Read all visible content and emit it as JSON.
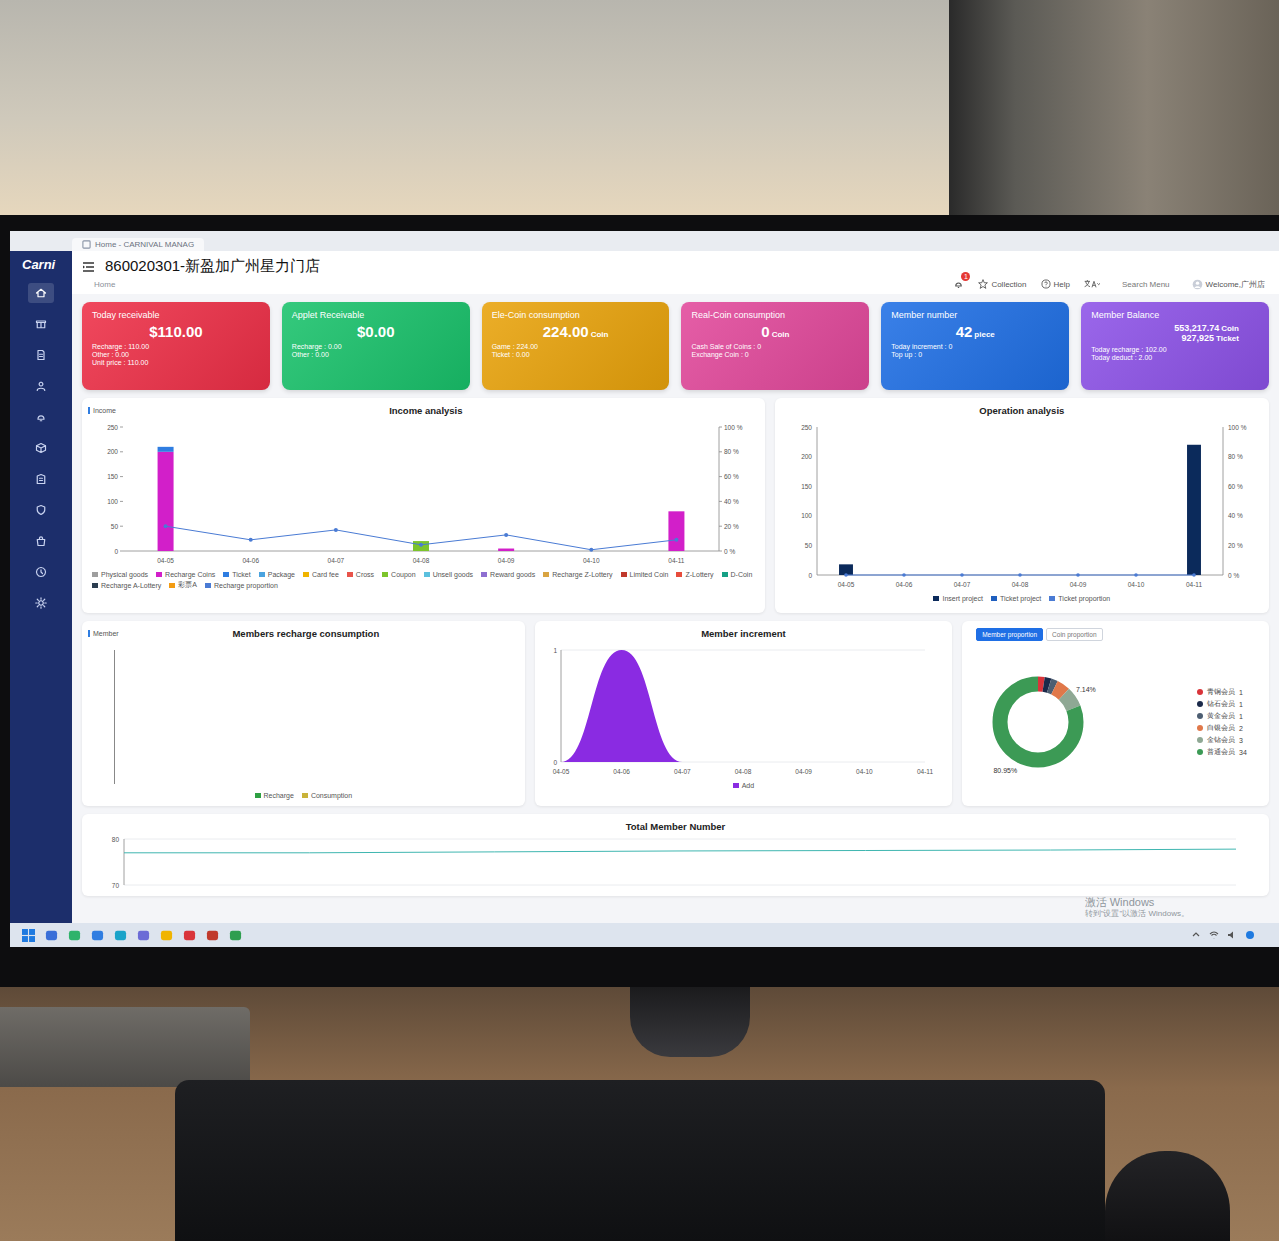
{
  "browser_tab": {
    "title": "Home - CARNIVAL MANAG"
  },
  "logo": "Carni",
  "sidebar": {
    "items": [
      {
        "selected": true
      },
      {
        "selected": false
      },
      {
        "selected": false
      },
      {
        "selected": false
      },
      {
        "selected": false
      },
      {
        "selected": false
      },
      {
        "selected": false
      },
      {
        "selected": false
      },
      {
        "selected": false
      },
      {
        "selected": false
      },
      {
        "selected": false
      }
    ]
  },
  "header": {
    "title": "860020301-新盈加广州星力门店",
    "breadcrumb": "Home",
    "notifications": "1",
    "collection": "Collection",
    "help": "Help",
    "search": "Search Menu",
    "welcome": "Welcome,广州店"
  },
  "cards": [
    {
      "title": "Today receivable",
      "color": "#ee2f47",
      "values": [
        {
          "value": "$110.00"
        }
      ],
      "lines": [
        "Recharge : 110.00",
        "Other : 0.00",
        "Unit price : 110.00"
      ]
    },
    {
      "title": "Applet Receivable",
      "color": "#19c26b",
      "values": [
        {
          "value": "$0.00"
        }
      ],
      "lines": [
        "Recharge : 0.00",
        "Other : 0.00"
      ]
    },
    {
      "title": "Ele-Coin consumption",
      "color": "#e9a30b",
      "values": [
        {
          "value": "224.00",
          "unit": "Coin"
        }
      ],
      "lines": [
        "Game : 224.00",
        "Ticket : 0.00"
      ]
    },
    {
      "title": "Real-Coin consumption",
      "color": "#e2489b",
      "values": [
        {
          "value": "0",
          "unit": "Coin"
        }
      ],
      "lines": [
        "Cash Sale of Coins : 0",
        "Exchange Coin : 0"
      ]
    },
    {
      "title": "Member number",
      "color": "#1f6fe5",
      "values": [
        {
          "value": "42",
          "unit": "piece"
        }
      ],
      "lines": [
        "Today increment : 0",
        "Top up : 0"
      ]
    },
    {
      "title": "Member Balance",
      "color": "#8d52e8",
      "values": [
        {
          "value": "553,217.74",
          "unit": "Coin"
        },
        {
          "value": "927,925",
          "unit": "Ticket"
        }
      ],
      "lines": [
        "Today recharge : 102.00",
        "Today deduct : 2.00"
      ]
    }
  ],
  "income": {
    "axis_label": "Income",
    "title": "Income analysis",
    "y_ticks": [
      "250",
      "200",
      "150",
      "100",
      "50",
      "0"
    ],
    "y2_ticks": [
      "100 %",
      "80 %",
      "60 %",
      "40 %",
      "20 %",
      "0 %"
    ],
    "categories": [
      "04-05",
      "04-06",
      "04-07",
      "04-08",
      "04-09",
      "04-10",
      "04-11"
    ],
    "series": [
      {
        "name": "Physical goods",
        "color": "#9e9e9e",
        "values": [
          0,
          0,
          0,
          0,
          0,
          0,
          0
        ]
      },
      {
        "name": "Recharge Coins",
        "color": "#d21fc9",
        "values": [
          200,
          0,
          0,
          0,
          5,
          0,
          80
        ]
      },
      {
        "name": "Ticket",
        "color": "#2f7de1",
        "values": [
          10,
          0,
          0,
          0,
          0,
          0,
          0
        ]
      },
      {
        "name": "Package",
        "color": "#4aa3df",
        "values": [
          0,
          0,
          0,
          0,
          0,
          0,
          0
        ]
      },
      {
        "name": "Card fee",
        "color": "#f0b400",
        "values": [
          0,
          0,
          0,
          0,
          0,
          0,
          0
        ]
      },
      {
        "name": "Cross",
        "color": "#e8534a",
        "values": [
          0,
          0,
          0,
          0,
          0,
          0,
          0
        ]
      },
      {
        "name": "Coupon",
        "color": "#7cc42b",
        "values": [
          0,
          0,
          0,
          20,
          0,
          0,
          0
        ]
      },
      {
        "name": "Unsell goods",
        "color": "#5bc0de",
        "values": [
          0,
          0,
          0,
          0,
          0,
          0,
          0
        ]
      },
      {
        "name": "Reward goods",
        "color": "#8e6fd1",
        "values": [
          0,
          0,
          0,
          0,
          0,
          0,
          0
        ]
      },
      {
        "name": "Recharge Z-Lottery",
        "color": "#d9a441",
        "values": [
          0,
          0,
          0,
          0,
          0,
          0,
          0
        ]
      },
      {
        "name": "Limited Coin",
        "color": "#c0392b",
        "values": [
          0,
          0,
          0,
          0,
          0,
          0,
          0
        ]
      },
      {
        "name": "Z-Lottery",
        "color": "#e74c3c",
        "values": [
          0,
          0,
          0,
          0,
          0,
          0,
          0
        ]
      },
      {
        "name": "D-Coin",
        "color": "#16a085",
        "values": [
          0,
          0,
          0,
          0,
          0,
          0,
          0
        ]
      },
      {
        "name": "Recharge A-Lottery",
        "color": "#2c3e50",
        "values": [
          0,
          0,
          0,
          0,
          0,
          0,
          0
        ]
      },
      {
        "name": "彩票A",
        "color": "#f39c12",
        "values": [
          0,
          0,
          0,
          0,
          0,
          0,
          0
        ]
      }
    ],
    "line": {
      "name": "Recharge proportion",
      "color": "#4a7bd4",
      "values": [
        20,
        9,
        17,
        5,
        13,
        1,
        9
      ]
    }
  },
  "operation": {
    "title": "Operation analysis",
    "y_ticks": [
      "250",
      "200",
      "150",
      "100",
      "50",
      "0"
    ],
    "y2_ticks": [
      "100 %",
      "80 %",
      "60 %",
      "40 %",
      "20 %",
      "0 %"
    ],
    "categories": [
      "04-05",
      "04-06",
      "04-07",
      "04-08",
      "04-09",
      "04-10",
      "04-11"
    ],
    "series": [
      {
        "name": "Insert project",
        "color": "#0b2a5b",
        "values": [
          18,
          0,
          0,
          0,
          0,
          0,
          220
        ]
      },
      {
        "name": "Ticket project",
        "color": "#1f5fbf",
        "values": [
          0,
          0,
          0,
          0,
          0,
          0,
          0
        ]
      }
    ],
    "line": {
      "name": "Ticket proportion",
      "color": "#4a7bd4",
      "values": [
        0,
        0,
        0,
        0,
        0,
        0,
        0
      ]
    }
  },
  "members_recharge": {
    "axis_label": "Member",
    "title": "Members recharge consumption",
    "legend": [
      {
        "name": "Recharge",
        "color": "#2ea043"
      },
      {
        "name": "Consumption",
        "color": "#c9b33a"
      }
    ]
  },
  "member_increment": {
    "title": "Member increment",
    "y_ticks": [
      "1",
      "0"
    ],
    "categories": [
      "04-05",
      "04-06",
      "04-07",
      "04-08",
      "04-09",
      "04-10",
      "04-11"
    ],
    "series": {
      "name": "Add",
      "color": "#8a2be2",
      "values": [
        0,
        1,
        0,
        0,
        0,
        0,
        0
      ]
    }
  },
  "proportion": {
    "tabs": [
      {
        "label": "Member proportion",
        "selected": true
      },
      {
        "label": "Coin proportion",
        "selected": false
      }
    ],
    "slices": [
      {
        "name": "青铜会员",
        "count": "1",
        "value": 1,
        "color": "#d9343a"
      },
      {
        "name": "钻石会员",
        "count": "1",
        "value": 1,
        "color": "#1b2a4a"
      },
      {
        "name": "黄金会员",
        "count": "1",
        "value": 1,
        "color": "#4d5e72"
      },
      {
        "name": "白银会员",
        "count": "2",
        "value": 2,
        "color": "#e0784a"
      },
      {
        "name": "金钻会员",
        "count": "3",
        "value": 3,
        "color": "#8fa894",
        "percent": "7.14%"
      },
      {
        "name": "普通会员",
        "count": "34",
        "value": 34,
        "color": "#3c9a55",
        "percent": "80.95%"
      }
    ]
  },
  "total_members": {
    "title": "Total Member Number",
    "y_ticks": [
      "80",
      "70"
    ],
    "values": [
      77,
      77,
      77.2,
      77.4,
      77.5,
      77.6,
      77.8
    ]
  },
  "watermark": {
    "line1": "激活 Windows",
    "line2": "转到\"设置\"以激活 Windows。"
  }
}
